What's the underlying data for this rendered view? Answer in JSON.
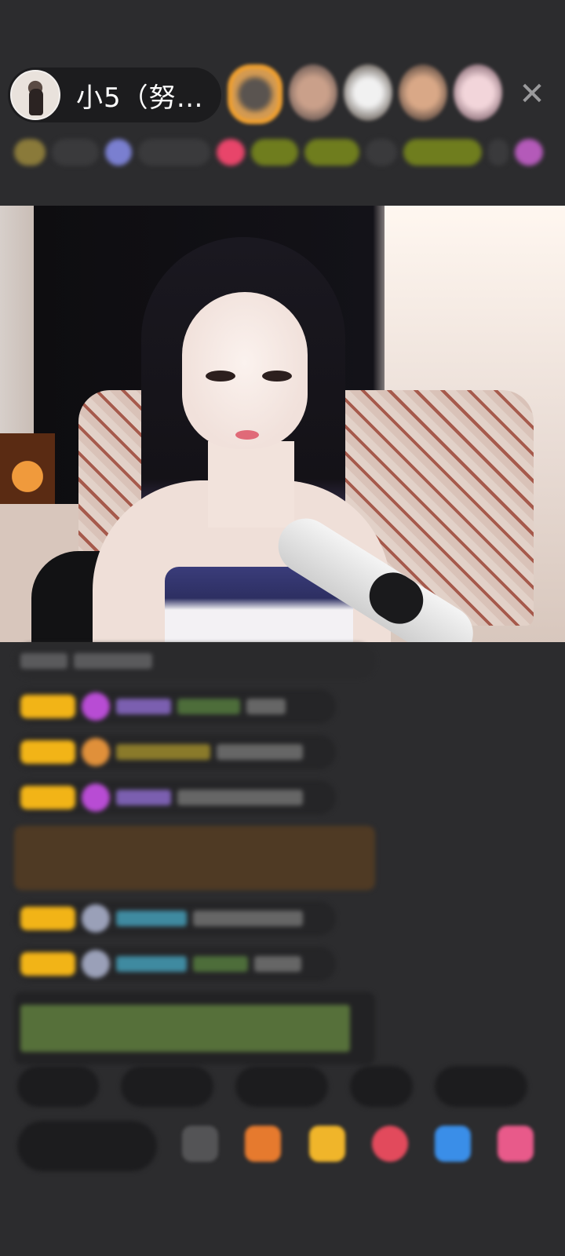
{
  "host": {
    "name": "小5（努…"
  },
  "close_label": "✕"
}
